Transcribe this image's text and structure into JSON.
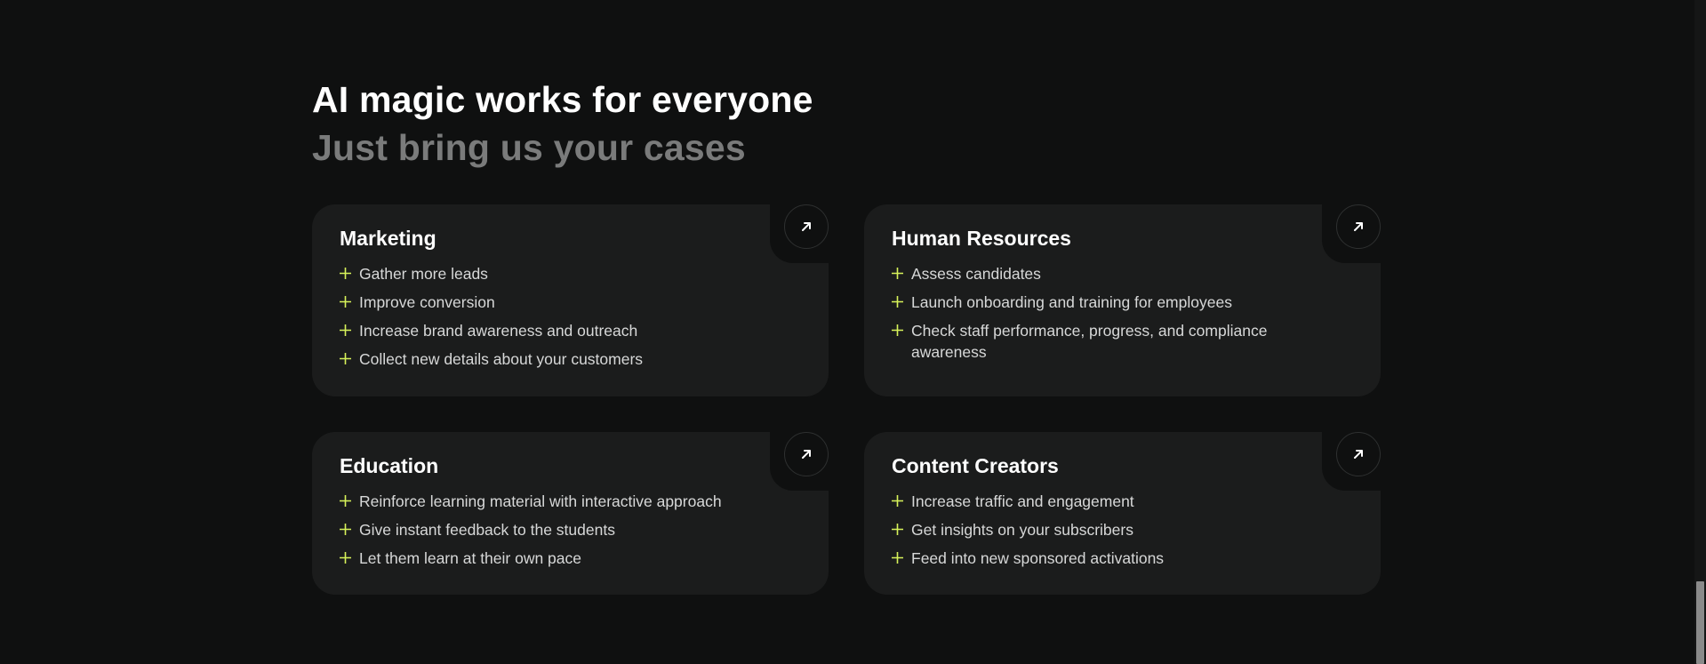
{
  "hero": {
    "title": "AI magic works for everyone",
    "subtitle": "Just bring us your cases"
  },
  "colors": {
    "background": "#0f1010",
    "card": "#1b1c1c",
    "accent": "#d7f25a",
    "muted": "#7a7b7b"
  },
  "icons": {
    "card_link": "arrow-up-right-icon",
    "bullet": "plus-sparkle-icon"
  },
  "cards": [
    {
      "title": "Marketing",
      "items": [
        "Gather more leads",
        "Improve conversion",
        "Increase brand awareness and outreach",
        "Collect new details about your customers"
      ]
    },
    {
      "title": "Human Resources",
      "items": [
        "Assess candidates",
        "Launch onboarding and training for employees",
        "Check staff performance, progress, and compliance awareness"
      ]
    },
    {
      "title": "Education",
      "items": [
        "Reinforce learning material with interactive approach",
        "Give instant feedback to the students",
        "Let them learn at their own pace"
      ]
    },
    {
      "title": "Content Creators",
      "items": [
        "Increase traffic and engagement",
        "Get insights on your subscribers",
        "Feed into new sponsored activations"
      ]
    }
  ]
}
